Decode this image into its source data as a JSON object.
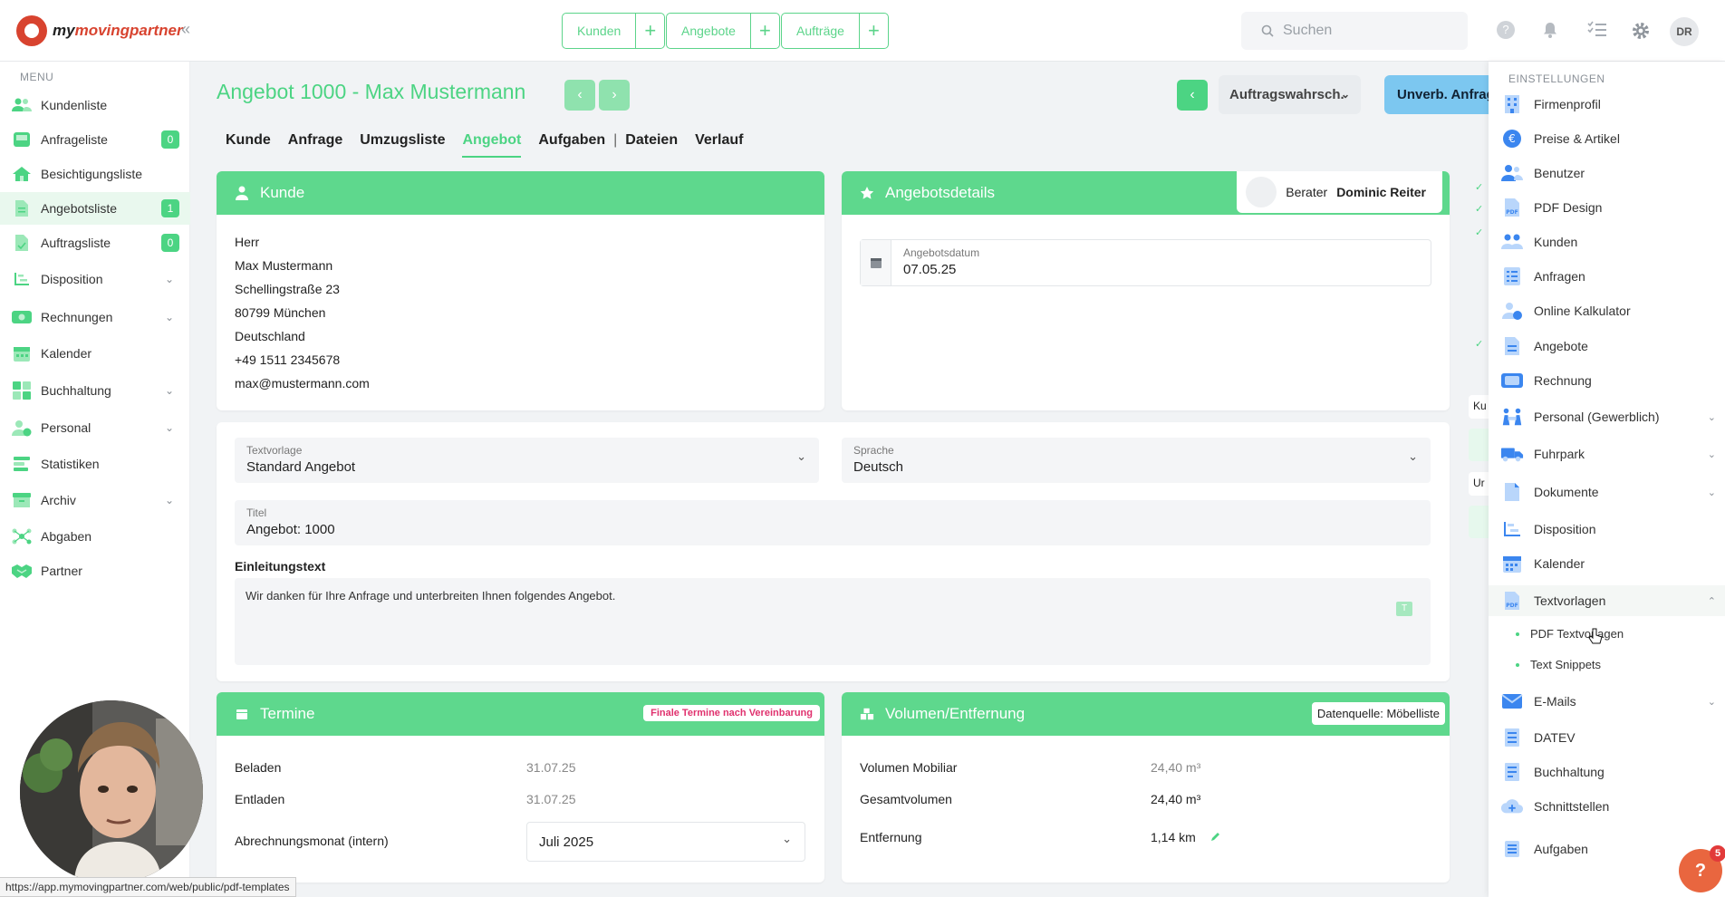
{
  "app": {
    "logo_prefix": "my",
    "logo_name": "movingpartner",
    "collapse_icon": "«"
  },
  "topbar": {
    "quick": [
      {
        "label": "Kunden",
        "plus": "+"
      },
      {
        "label": "Angebote",
        "plus": "+"
      },
      {
        "label": "Aufträge",
        "plus": "+"
      }
    ],
    "search_placeholder": "Suchen",
    "avatar_initials": "DR"
  },
  "sidebar": {
    "heading": "MENU",
    "items": [
      {
        "label": "Kundenliste",
        "icon": "users-icon",
        "badge": ""
      },
      {
        "label": "Anfrageliste",
        "icon": "inbox-icon",
        "badge": "0"
      },
      {
        "label": "Besichtigungsliste",
        "icon": "house-icon",
        "badge": ""
      },
      {
        "label": "Angebotsliste",
        "icon": "offer-document-icon",
        "badge": "1"
      },
      {
        "label": "Auftragsliste",
        "icon": "order-document-icon",
        "badge": "0"
      },
      {
        "label": "Disposition",
        "icon": "disposition-icon",
        "chevron": "⌄"
      },
      {
        "label": "Rechnungen",
        "icon": "invoice-icon",
        "chevron": "⌄"
      },
      {
        "label": "Kalender",
        "icon": "calendar-icon",
        "chevron": ""
      },
      {
        "label": "Buchhaltung",
        "icon": "accounting-icon",
        "chevron": "⌄"
      },
      {
        "label": "Personal",
        "icon": "staff-icon",
        "chevron": "⌄"
      },
      {
        "label": "Statistiken",
        "icon": "statistics-icon",
        "chevron": ""
      },
      {
        "label": "Archiv",
        "icon": "archive-icon",
        "chevron": "⌄"
      },
      {
        "label": "Abgaben",
        "icon": "network-icon",
        "chevron": ""
      },
      {
        "label": "Partner",
        "icon": "handshake-icon",
        "chevron": ""
      }
    ]
  },
  "header": {
    "title": "Angebot 1000 - Max Mustermann",
    "prev_arrow": "‹",
    "next_arrow": "›",
    "back_arrow": "‹",
    "status_select": "Auftragswahrsch.",
    "unverb_button": "Unverb. Anfrage"
  },
  "tabs": [
    "Kunde",
    "Anfrage",
    "Umzugsliste",
    "Angebot",
    "Aufgaben",
    "Dateien",
    "Verlauf"
  ],
  "tab_separator": "|",
  "customer_card": {
    "title": "Kunde",
    "lines": [
      "Herr",
      "Max Mustermann",
      "Schellingstraße 23",
      "80799 München",
      "Deutschland",
      "+49 1511 2345678",
      "max@mustermann.com"
    ]
  },
  "offer_details": {
    "title": "Angebotsdetails",
    "berater_label": "Berater",
    "berater_name": "Dominic Reiter",
    "date_label": "Angebotsdatum",
    "date_value": "07.05.25"
  },
  "text_section": {
    "template_label": "Textvorlage",
    "template_value": "Standard Angebot",
    "language_label": "Sprache",
    "language_value": "Deutsch",
    "title_label": "Titel",
    "title_value": "Angebot: 1000",
    "intro_label": "Einleitungstext",
    "intro_value": "Wir danken für Ihre Anfrage und unterbreiten Ihnen folgendes Angebot.",
    "insert_icon_label": "T"
  },
  "termine": {
    "title": "Termine",
    "badge": "Finale Termine nach Vereinbarung",
    "rows": [
      {
        "label": "Beladen",
        "value": "31.07.25"
      },
      {
        "label": "Entladen",
        "value": "31.07.25"
      }
    ],
    "billing_label": "Abrechnungsmonat (intern)",
    "billing_value": "Juli 2025"
  },
  "volume": {
    "title": "Volumen/Entfernung",
    "source_badge": "Datenquelle: Möbelliste",
    "rows": [
      {
        "label": "Volumen Mobiliar",
        "value": "24,40 m³"
      },
      {
        "label": "Gesamtvolumen",
        "value": "24,40 m³"
      },
      {
        "label": "Entfernung",
        "value": "1,14 km"
      }
    ]
  },
  "peek": {
    "label_a": "Ku",
    "label_b": "Ur"
  },
  "settings": {
    "heading": "EINSTELLUNGEN",
    "items": [
      {
        "label": "Firmenprofil",
        "icon": "building-icon",
        "chevron": ""
      },
      {
        "label": "Preise & Artikel",
        "icon": "euro-icon",
        "chevron": ""
      },
      {
        "label": "Benutzer",
        "icon": "users-icon",
        "chevron": ""
      },
      {
        "label": "PDF Design",
        "icon": "pdf-icon",
        "chevron": ""
      },
      {
        "label": "Kunden",
        "icon": "customers-icon",
        "chevron": ""
      },
      {
        "label": "Anfragen",
        "icon": "checklist-icon",
        "chevron": ""
      },
      {
        "label": "Online Kalkulator",
        "icon": "calculator-user-icon",
        "chevron": ""
      },
      {
        "label": "Angebote",
        "icon": "offer-document-icon",
        "chevron": ""
      },
      {
        "label": "Rechnung",
        "icon": "invoice-icon",
        "chevron": ""
      },
      {
        "label": "Personal (Gewerblich)",
        "icon": "workers-icon",
        "chevron": "⌄"
      },
      {
        "label": "Fuhrpark",
        "icon": "truck-icon",
        "chevron": "⌄"
      },
      {
        "label": "Dokumente",
        "icon": "document-icon",
        "chevron": "⌄"
      },
      {
        "label": "Disposition",
        "icon": "disposition-icon",
        "chevron": ""
      },
      {
        "label": "Kalender",
        "icon": "calendar-icon",
        "chevron": ""
      },
      {
        "label": "Textvorlagen",
        "icon": "pdf-icon",
        "chevron": "⌃"
      },
      {
        "label": "E-Mails",
        "icon": "mail-icon",
        "chevron": "⌄"
      },
      {
        "label": "DATEV",
        "icon": "datev-icon",
        "chevron": ""
      },
      {
        "label": "Buchhaltung",
        "icon": "ledger-icon",
        "chevron": ""
      },
      {
        "label": "Schnittstellen",
        "icon": "cloud-icon",
        "chevron": ""
      },
      {
        "label": "Aufgaben",
        "icon": "tasks-icon",
        "chevron": ""
      }
    ],
    "sub_items": [
      "PDF Textvorlagen",
      "Text Snippets"
    ]
  },
  "status_url": "https://app.mymovingpartner.com/web/public/pdf-templates",
  "help": {
    "label": "?",
    "badge": "5"
  },
  "colors": {
    "primary": "#4cd483",
    "header_green": "#5ed88d",
    "accent_blue": "#7cc7f0",
    "brand_red": "#d8432f",
    "pink": "#e0316e"
  }
}
